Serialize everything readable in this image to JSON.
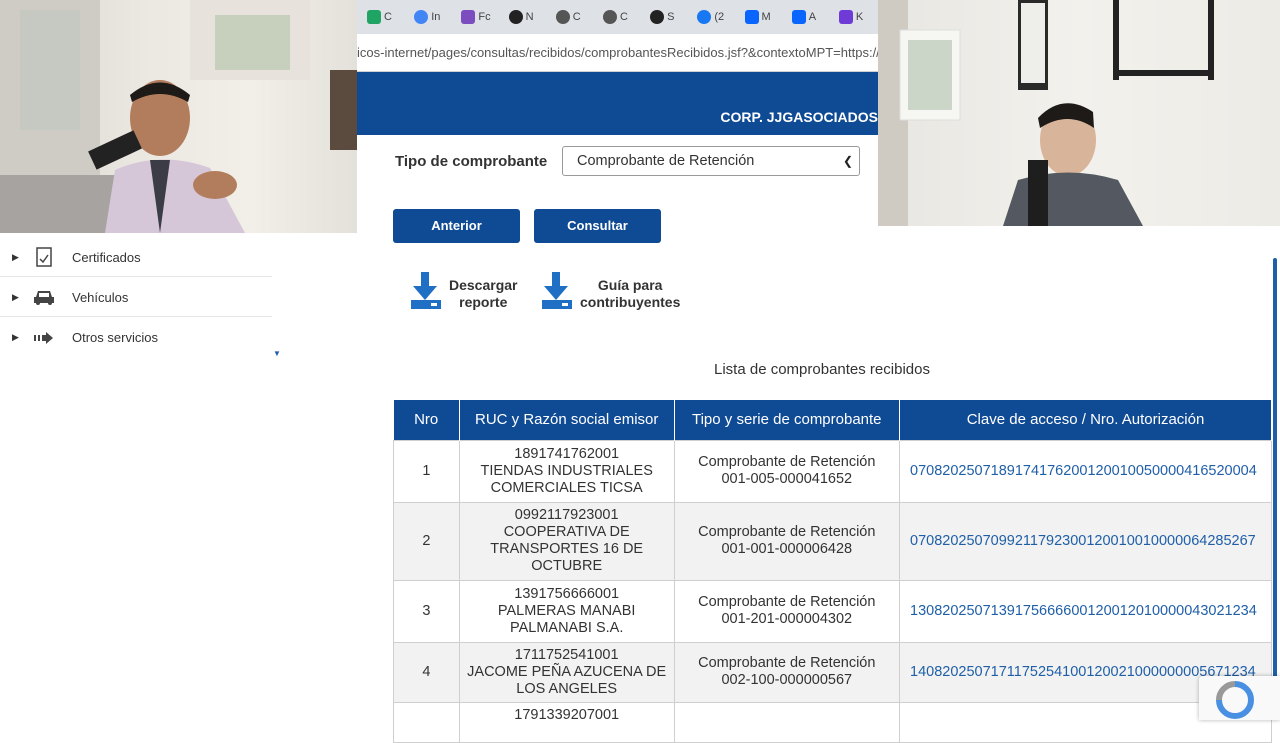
{
  "browser": {
    "tabs": [
      {
        "label": "C",
        "color": "#1fa463"
      },
      {
        "label": "In",
        "color": "#4285f4"
      },
      {
        "label": "Fc",
        "color": "#7b4dbf"
      },
      {
        "label": "N",
        "color": "#222222"
      },
      {
        "label": "C",
        "color": "#333333"
      },
      {
        "label": "C",
        "color": "#333333"
      },
      {
        "label": "S",
        "color": "#222222"
      },
      {
        "label": "(2",
        "color": "#1877f2"
      },
      {
        "label": "M",
        "color": "#0866ff"
      },
      {
        "label": "A",
        "color": "#0866ff"
      },
      {
        "label": "K",
        "color": "#6e3bd6"
      }
    ],
    "url": "icos-internet/pages/consultas/recibidos/comprobantesRecibidos.jsf?&contextoMPT=https://srienli..."
  },
  "header": {
    "org_name": "CORP. JJGASOCIADOS"
  },
  "form": {
    "tipo_label": "Tipo de comprobante",
    "tipo_value": "Comprobante de Retención",
    "anterior_label": "Anterior",
    "consultar_label": "Consultar"
  },
  "downloads": {
    "reporte": {
      "line1": "Descargar",
      "line2": "reporte"
    },
    "guia": {
      "line1": "Guía para",
      "line2": "contribuyentes"
    }
  },
  "sidebar": {
    "items": [
      {
        "label": "Certificados",
        "icon": "certificate-icon"
      },
      {
        "label": "Vehículos",
        "icon": "car-icon"
      },
      {
        "label": "Otros servicios",
        "icon": "arrow-right-icon"
      }
    ]
  },
  "table": {
    "title": "Lista de comprobantes recibidos",
    "headers": [
      "Nro",
      "RUC y Razón social emisor",
      "Tipo y serie de comprobante",
      "Clave de acceso / Nro. Autorización"
    ],
    "rows": [
      {
        "nro": "1",
        "ruc": "1891741762001",
        "razon1": "TIENDAS INDUSTRIALES",
        "razon2": "COMERCIALES TICSA",
        "razon3": "",
        "tipo": "Comprobante de Retención",
        "serie": "001-005-000041652",
        "clave": "0708202507189174176200120010050000416520004"
      },
      {
        "nro": "2",
        "ruc": "0992117923001",
        "razon1": "COOPERATIVA DE",
        "razon2": "TRANSPORTES 16 DE",
        "razon3": "OCTUBRE",
        "tipo": "Comprobante de Retención",
        "serie": "001-001-000006428",
        "clave": "0708202507099211792300120010010000064285267"
      },
      {
        "nro": "3",
        "ruc": "1391756666001",
        "razon1": "PALMERAS MANABI",
        "razon2": "PALMANABI S.A.",
        "razon3": "",
        "tipo": "Comprobante de Retención",
        "serie": "001-201-000004302",
        "clave": "1308202507139175666600120012010000043021234"
      },
      {
        "nro": "4",
        "ruc": "1711752541001",
        "razon1": "JACOME PEÑA AZUCENA DE",
        "razon2": "LOS ANGELES",
        "razon3": "",
        "tipo": "Comprobante de Retención",
        "serie": "002-100-000000567",
        "clave": "1408202507171175254100120021000000005671234"
      },
      {
        "nro": "",
        "ruc": "1791339207001",
        "razon1": "",
        "razon2": "",
        "razon3": "",
        "tipo": "",
        "serie": "",
        "clave": ""
      }
    ]
  }
}
